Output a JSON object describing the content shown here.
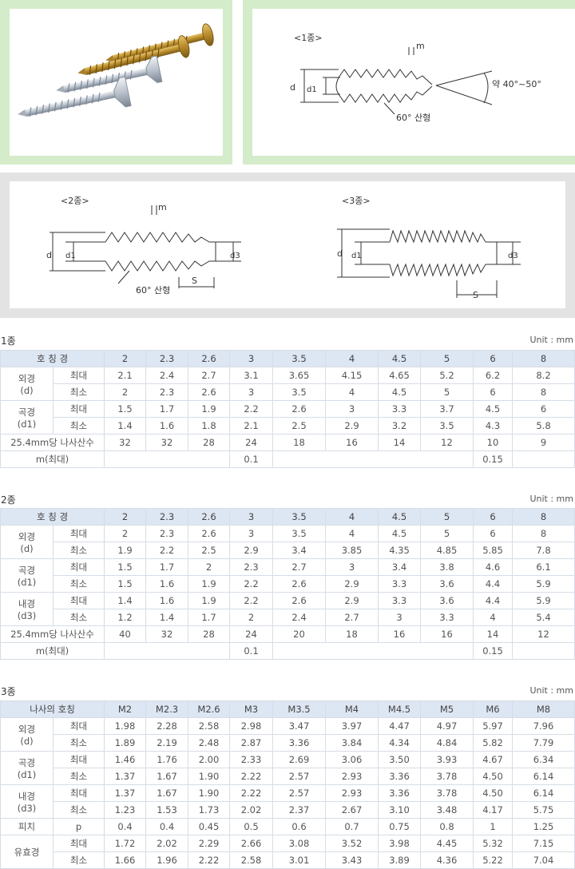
{
  "diagrams": {
    "type1": {
      "title": "<1종>",
      "m": "m",
      "d": "d",
      "d1": "d1",
      "angle": "60° 산형",
      "tip": "약 40°~50°"
    },
    "type2": {
      "title": "<2종>",
      "m": "m",
      "d": "d",
      "d1": "d1",
      "d3": "d3",
      "angle": "60° 산형",
      "s": "S"
    },
    "type3": {
      "title": "<3종>",
      "d": "d",
      "d1": "d1",
      "d3": "d3",
      "s": "S"
    }
  },
  "table1": {
    "title": "1종",
    "unit": "Unit : mm",
    "corner": "호 칭 경",
    "headers": [
      "2",
      "2.3",
      "2.6",
      "3",
      "3.5",
      "4",
      "4.5",
      "5",
      "6",
      "8"
    ],
    "groups": [
      {
        "label": "외경",
        "sub": "(d)",
        "rows": [
          {
            "label": "최대",
            "values": [
              "2.1",
              "2.4",
              "2.7",
              "3.1",
              "3.65",
              "4.15",
              "4.65",
              "5.2",
              "6.2",
              "8.2"
            ]
          },
          {
            "label": "최소",
            "values": [
              "2",
              "2.3",
              "2.6",
              "3",
              "3.5",
              "4",
              "4.5",
              "5",
              "6",
              "8"
            ]
          }
        ]
      },
      {
        "label": "곡경",
        "sub": "(d1)",
        "rows": [
          {
            "label": "최대",
            "values": [
              "1.5",
              "1.7",
              "1.9",
              "2.2",
              "2.6",
              "3",
              "3.3",
              "3.7",
              "4.5",
              "6"
            ]
          },
          {
            "label": "최소",
            "values": [
              "1.4",
              "1.6",
              "1.8",
              "2.1",
              "2.5",
              "2.9",
              "3.2",
              "3.5",
              "4.3",
              "5.8"
            ]
          }
        ]
      }
    ],
    "thread_label": "25.4mm당 나사산수",
    "thread_values": [
      "32",
      "32",
      "28",
      "24",
      "18",
      "16",
      "14",
      "12",
      "10",
      "9"
    ],
    "m_label": "m(최대)",
    "m_values": [
      "0.1",
      "0.15"
    ]
  },
  "table2": {
    "title": "2종",
    "unit": "Unit : mm",
    "corner": "호 칭 경",
    "headers": [
      "2",
      "2.3",
      "2.6",
      "3",
      "3.5",
      "4",
      "4.5",
      "5",
      "6",
      "8"
    ],
    "groups": [
      {
        "label": "외경",
        "sub": "(d)",
        "rows": [
          {
            "label": "최대",
            "values": [
              "2",
              "2.3",
              "2.6",
              "3",
              "3.5",
              "4",
              "4.5",
              "5",
              "6",
              "8"
            ]
          },
          {
            "label": "최소",
            "values": [
              "1.9",
              "2.2",
              "2.5",
              "2.9",
              "3.4",
              "3.85",
              "4.35",
              "4.85",
              "5.85",
              "7.8"
            ]
          }
        ]
      },
      {
        "label": "곡경",
        "sub": "(d1)",
        "rows": [
          {
            "label": "최대",
            "values": [
              "1.5",
              "1.7",
              "2",
              "2.3",
              "2.7",
              "3",
              "3.4",
              "3.8",
              "4.6",
              "6.1"
            ]
          },
          {
            "label": "최소",
            "values": [
              "1.5",
              "1.6",
              "1.9",
              "2.2",
              "2.6",
              "2.9",
              "3.3",
              "3.6",
              "4.4",
              "5.9"
            ]
          }
        ]
      },
      {
        "label": "내경",
        "sub": "(d3)",
        "rows": [
          {
            "label": "최대",
            "values": [
              "1.4",
              "1.6",
              "1.9",
              "2.2",
              "2.6",
              "2.9",
              "3.3",
              "3.6",
              "4.4",
              "5.9"
            ]
          },
          {
            "label": "최소",
            "values": [
              "1.2",
              "1.4",
              "1.7",
              "2",
              "2.4",
              "2.7",
              "3",
              "3.3",
              "4",
              "5.4"
            ]
          }
        ]
      }
    ],
    "thread_label": "25.4mm당 나사산수",
    "thread_values": [
      "40",
      "32",
      "28",
      "24",
      "20",
      "18",
      "16",
      "16",
      "14",
      "12"
    ],
    "m_label": "m(최대)",
    "m_values": [
      "0.1",
      "0.15"
    ]
  },
  "table3": {
    "title": "3종",
    "unit": "Unit : mm",
    "corner": "나사의 호칭",
    "headers": [
      "M2",
      "M2.3",
      "M2.6",
      "M3",
      "M3.5",
      "M4",
      "M4.5",
      "M5",
      "M6",
      "M8"
    ],
    "groups": [
      {
        "label": "외경",
        "sub": "(d)",
        "rows": [
          {
            "label": "최대",
            "values": [
              "1.98",
              "2.28",
              "2.58",
              "2.98",
              "3.47",
              "3.97",
              "4.47",
              "4.97",
              "5.97",
              "7.96"
            ]
          },
          {
            "label": "최소",
            "values": [
              "1.89",
              "2.19",
              "2.48",
              "2.87",
              "3.36",
              "3.84",
              "4.34",
              "4.84",
              "5.82",
              "7.79"
            ]
          }
        ]
      },
      {
        "label": "곡경",
        "sub": "(d1)",
        "rows": [
          {
            "label": "최대",
            "values": [
              "1.46",
              "1.76",
              "2.00",
              "2.33",
              "2.69",
              "3.06",
              "3.50",
              "3.93",
              "4.67",
              "6.34"
            ]
          },
          {
            "label": "최소",
            "values": [
              "1.37",
              "1.67",
              "1.90",
              "2.22",
              "2.57",
              "2.93",
              "3.36",
              "3.78",
              "4.50",
              "6.14"
            ]
          }
        ]
      },
      {
        "label": "내경",
        "sub": "(d3)",
        "rows": [
          {
            "label": "최대",
            "values": [
              "1.37",
              "1.67",
              "1.90",
              "2.22",
              "2.57",
              "2.93",
              "3.36",
              "3.78",
              "4.50",
              "6.14"
            ]
          },
          {
            "label": "최소",
            "values": [
              "1.23",
              "1.53",
              "1.73",
              "2.02",
              "2.37",
              "2.67",
              "3.10",
              "3.48",
              "4.17",
              "5.75"
            ]
          }
        ]
      }
    ],
    "pitch_label": "피치",
    "pitch_sub": "p",
    "pitch_values": [
      "0.4",
      "0.4",
      "0.45",
      "0.5",
      "0.6",
      "0.7",
      "0.75",
      "0.8",
      "1",
      "1.25"
    ],
    "eff_label": "유효경",
    "eff_rows": [
      {
        "label": "최대",
        "values": [
          "1.72",
          "2.02",
          "2.29",
          "2.66",
          "3.08",
          "3.52",
          "3.98",
          "4.45",
          "5.32",
          "7.15"
        ]
      },
      {
        "label": "최소",
        "values": [
          "1.66",
          "1.96",
          "2.22",
          "2.58",
          "3.01",
          "3.43",
          "3.89",
          "4.36",
          "5.22",
          "7.04"
        ]
      }
    ]
  }
}
